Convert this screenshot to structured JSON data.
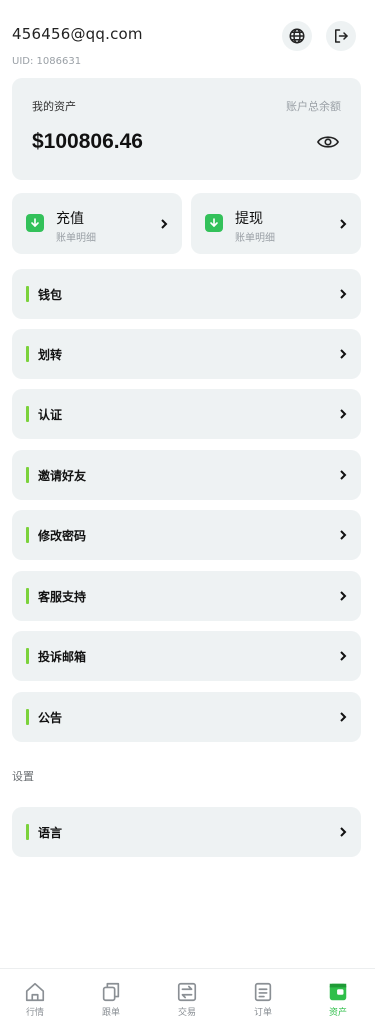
{
  "header": {
    "email": "456456@qq.com",
    "uid": "UID: 1086631"
  },
  "asset": {
    "title": "我的资产",
    "total_label": "账户总余额",
    "amount": "$100806.46"
  },
  "actions": [
    {
      "title": "充值",
      "subtitle": "账单明细"
    },
    {
      "title": "提现",
      "subtitle": "账单明细"
    }
  ],
  "menu": [
    {
      "label": "钱包"
    },
    {
      "label": "划转"
    },
    {
      "label": "认证"
    },
    {
      "label": "邀请好友"
    },
    {
      "label": "修改密码"
    },
    {
      "label": "客服支持"
    },
    {
      "label": "投诉邮箱"
    },
    {
      "label": "公告"
    }
  ],
  "settings": {
    "section_label": "设置",
    "items": [
      {
        "label": "语言"
      }
    ]
  },
  "tabbar": {
    "items": [
      {
        "label": "行情",
        "icon": "home-icon"
      },
      {
        "label": "跟单",
        "icon": "copy-icon"
      },
      {
        "label": "交易",
        "icon": "exchange-icon"
      },
      {
        "label": "订单",
        "icon": "orders-icon"
      },
      {
        "label": "资产",
        "icon": "wallet-icon",
        "active": true
      }
    ]
  },
  "colors": {
    "accent": "#2fbf4a",
    "menu_bar": "#7bd23b",
    "card_bg": "#eef2f3"
  }
}
